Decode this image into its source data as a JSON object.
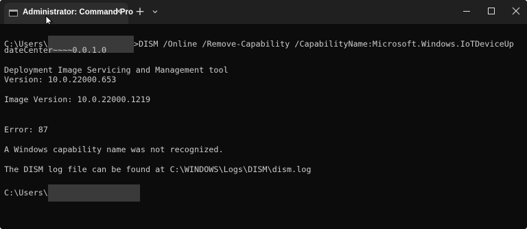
{
  "window": {
    "tab_title": "Administrator: Command Pro",
    "tab_close_glyph": "✕",
    "new_tab_glyph": "+"
  },
  "console": {
    "cmd_prefix": "C:\\Users\\",
    "cmd_rest": ">DISM /Online /Remove-Capability /CapabilityName:Microsoft.Windows.IoTDeviceUp",
    "cmd_wrap": "dateCenter~~~~0.0.1.0",
    "tool_name": "Deployment Image Servicing and Management tool",
    "version": "Version: 10.0.22000.653",
    "image_version": "Image Version: 10.0.22000.1219",
    "error": "Error: 87",
    "error_message": "A Windows capability name was not recognized.",
    "log_message": "The DISM log file can be found at C:\\WINDOWS\\Logs\\DISM\\dism.log",
    "prompt_prefix": "C:\\Users\\"
  }
}
